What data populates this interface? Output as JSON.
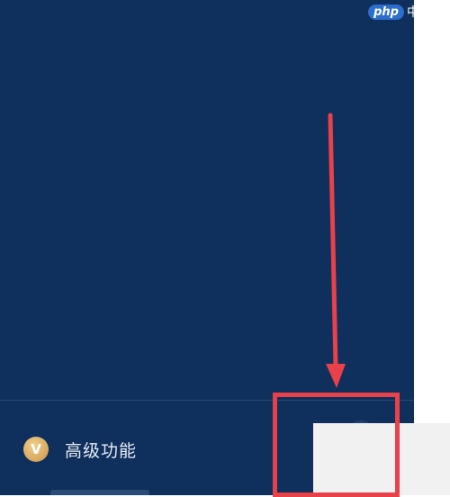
{
  "menu": {
    "items": [
      {
        "label": "高级功能",
        "icon": "vip-badge-icon",
        "icon_glyph": "V"
      }
    ]
  },
  "watermark": {
    "brand": "php",
    "suffix": "中文网"
  },
  "colors": {
    "panel": "#0f2f5c",
    "annotation": "#e8414a",
    "vip_gold": "#d4a45a"
  }
}
